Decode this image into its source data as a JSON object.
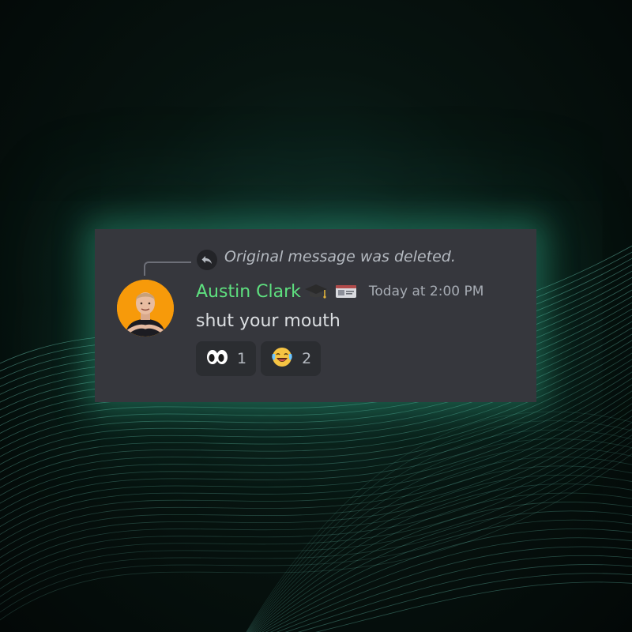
{
  "reply": {
    "text": "Original message was deleted.",
    "icon": "reply-icon"
  },
  "author": {
    "name": "Austin Clark",
    "name_color": "#5ee07f",
    "badges": [
      "graduation-cap-icon",
      "id-card-icon"
    ],
    "avatar_bg": "#f79a0a"
  },
  "message": {
    "timestamp": "Today at 2:00 PM",
    "content": "shut your mouth"
  },
  "reactions": [
    {
      "emoji": "👀",
      "icon": "eyes-emoji-icon",
      "count": "1"
    },
    {
      "emoji": "😂",
      "icon": "laughing-tears-emoji-icon",
      "count": "2"
    }
  ],
  "colors": {
    "card_bg": "#36373d",
    "reaction_bg": "#2b2d31",
    "glow": "#3cc8a0"
  }
}
